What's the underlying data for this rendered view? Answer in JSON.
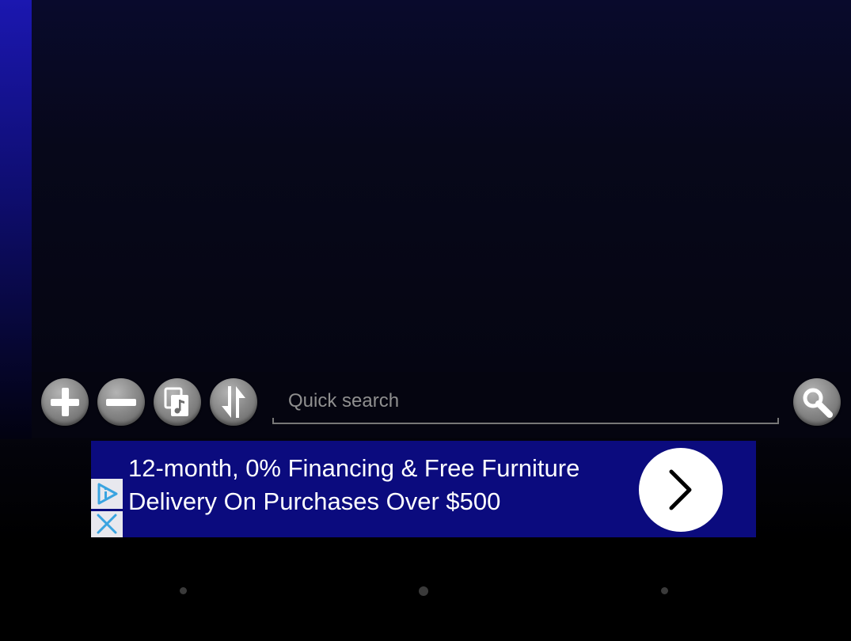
{
  "toolbar": {
    "buttons": [
      {
        "name": "add-icon"
      },
      {
        "name": "remove-icon"
      },
      {
        "name": "copy-music-icon"
      },
      {
        "name": "swap-icon"
      }
    ],
    "search": {
      "placeholder": "Quick search",
      "value": ""
    },
    "search_button": {
      "icon": "search-icon"
    }
  },
  "ad": {
    "line1": "12-month, 0% Financing & Free Furniture",
    "line2": "Delivery On Purchases Over $500",
    "info_icon": "ad-choices-icon",
    "close_icon": "close-icon",
    "cta_icon": "chevron-right-icon"
  },
  "colors": {
    "left_strip": "#1b17b0",
    "ad_background": "#0b0b7e",
    "ad_accent": "#3aa4e0",
    "button_gray": "#8a8a8a"
  }
}
